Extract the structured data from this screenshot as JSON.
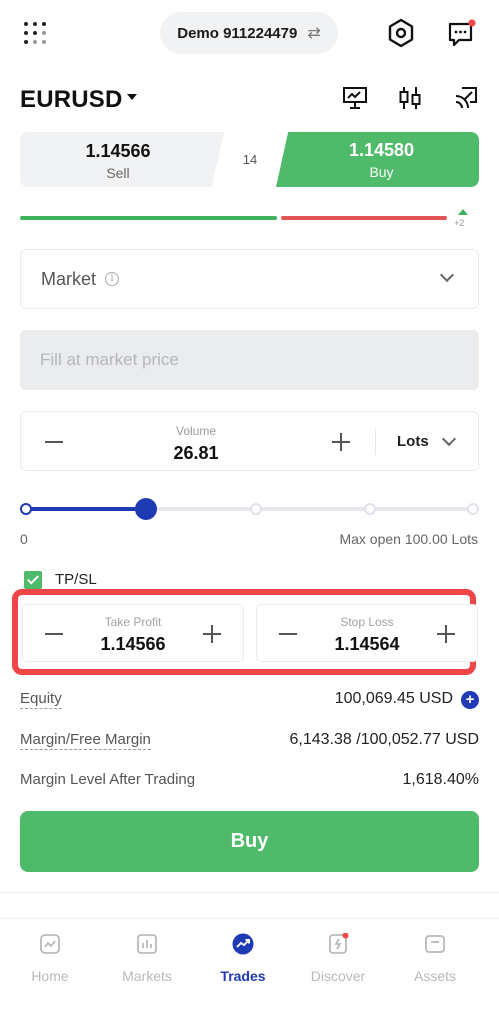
{
  "header": {
    "account_label": "Demo 911224479",
    "menu_icon": "grid-dots-icon",
    "settings_icon": "hexagon-settings-icon",
    "messages_icon": "chat-bubble-icon"
  },
  "symbol": {
    "name": "EURUSD",
    "tools": [
      "presentation-chart-icon",
      "candlestick-icon",
      "cast-icon"
    ]
  },
  "quote": {
    "sell_price": "1.14566",
    "sell_label": "Sell",
    "spread": "14",
    "buy_price": "1.14580",
    "buy_label": "Buy",
    "sentiment_delta": "+2"
  },
  "order_type": {
    "label": "Market"
  },
  "price_field": {
    "placeholder": "Fill at market price"
  },
  "volume": {
    "label": "Volume",
    "value": "26.81",
    "unit": "Lots"
  },
  "slider": {
    "min_label": "0",
    "max_label": "Max open 100.00 Lots",
    "fraction": 0.27
  },
  "tpsl": {
    "label": "TP/SL",
    "checked": true,
    "take_profit_label": "Take Profit",
    "take_profit_value": "1.14566",
    "stop_loss_label": "Stop Loss",
    "stop_loss_value": "1.14564"
  },
  "account_info": {
    "equity_label": "Equity",
    "equity_value": "100,069.45 USD",
    "margin_label": "Margin/Free Margin",
    "margin_value": "6,143.38 /100,052.77 USD",
    "margin_level_label": "Margin Level After Trading",
    "margin_level_value": "1,618.40%"
  },
  "action": {
    "buy_button_label": "Buy"
  },
  "nav": {
    "items": [
      {
        "label": "Home",
        "icon": "home-chart-icon"
      },
      {
        "label": "Markets",
        "icon": "markets-bars-icon"
      },
      {
        "label": "Trades",
        "icon": "trades-trend-icon"
      },
      {
        "label": "Discover",
        "icon": "discover-icon"
      },
      {
        "label": "Assets",
        "icon": "assets-wallet-icon"
      }
    ],
    "active": "Trades"
  },
  "colors": {
    "buy_green": "#4fba6a",
    "sell_red": "#e05454",
    "accent_blue": "#1f3bb3",
    "highlight_red": "#ef4747"
  }
}
